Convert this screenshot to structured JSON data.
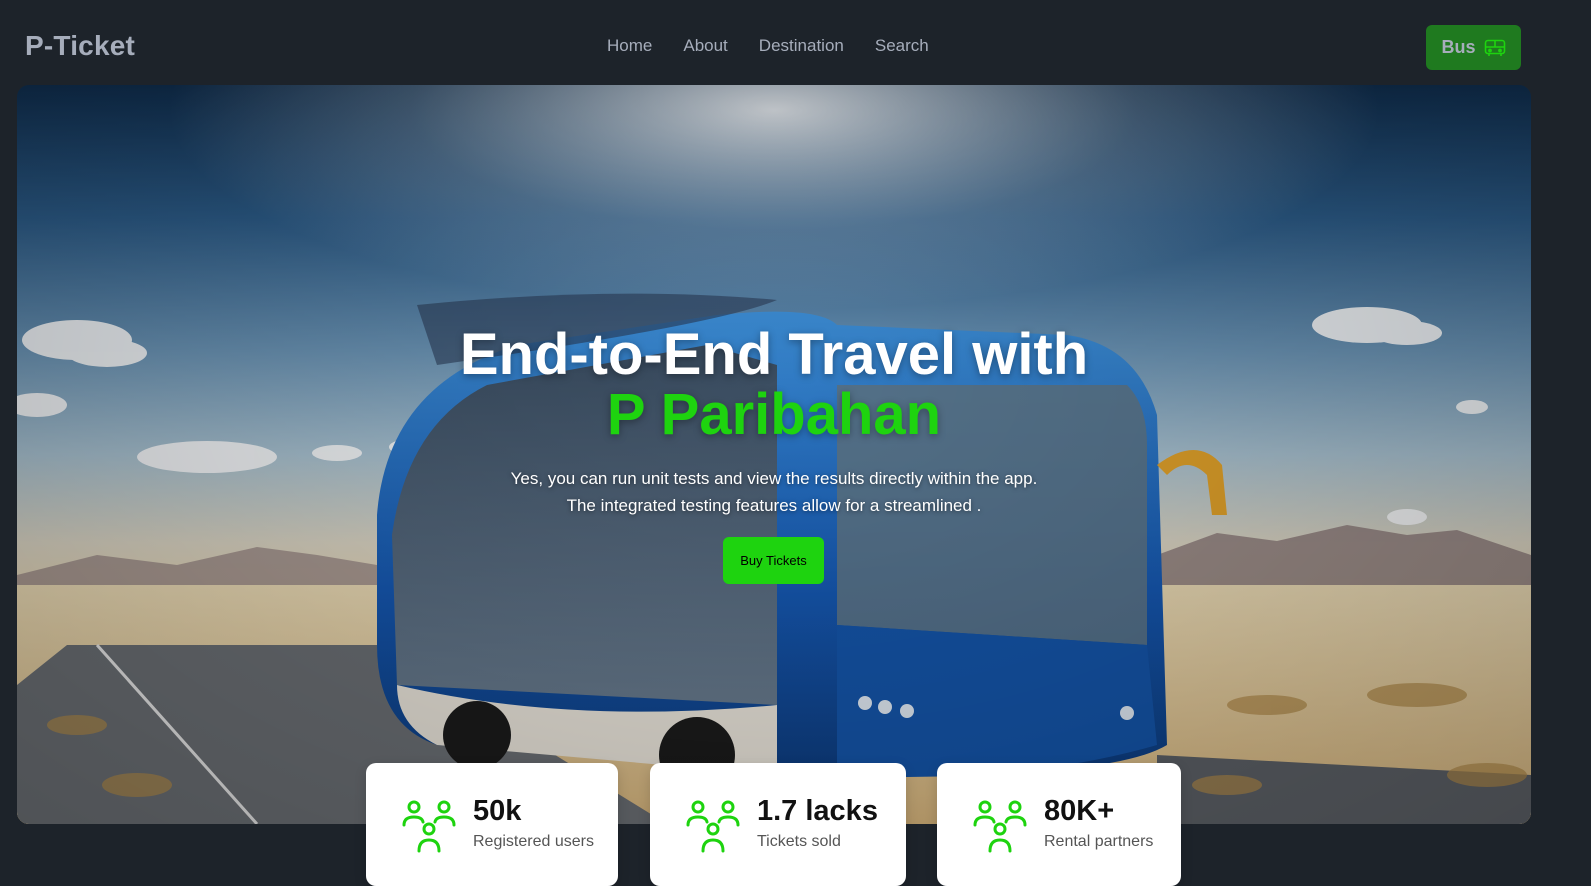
{
  "brand": "P-Ticket",
  "nav": {
    "links": [
      "Home",
      "About",
      "Destination",
      "Search"
    ],
    "bus_label": "Bus"
  },
  "hero": {
    "title_line1": "End-to-End Travel with",
    "title_line2": "P Paribahan",
    "desc_line1": "Yes, you can run unit tests and view the results directly within the app.",
    "desc_line2": "The integrated testing features allow for a streamlined .",
    "cta_label": "Buy Tickets"
  },
  "stats": [
    {
      "value": "50k",
      "label": "Registered users",
      "icon": "users-icon"
    },
    {
      "value": "1.7 lacks",
      "label": "Tickets sold",
      "icon": "users-icon"
    },
    {
      "value": "80K+",
      "label": "Rental partners",
      "icon": "users-icon"
    }
  ],
  "colors": {
    "accent": "#1ed30f",
    "bus_button": "#1f7a1f",
    "page_bg": "#1d232a",
    "nav_text": "#a6adbb"
  }
}
